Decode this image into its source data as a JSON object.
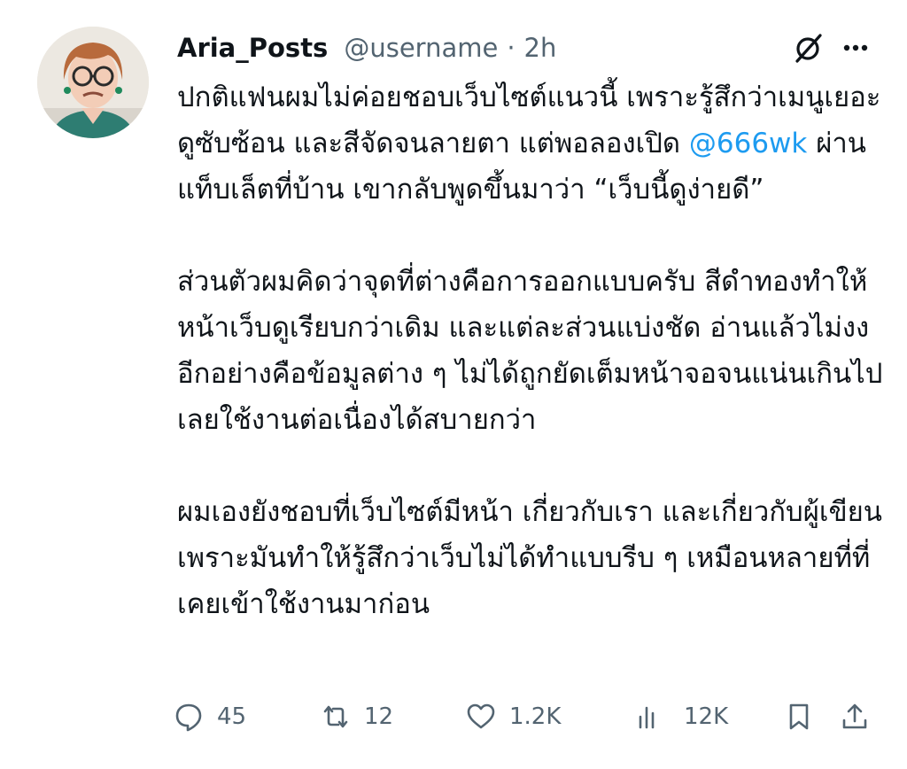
{
  "post": {
    "display_name": "Aria_Posts",
    "handle": "@username",
    "separator": "·",
    "time": "2h",
    "body": {
      "p1_before": "ปกติแฟนผมไม่ค่อยชอบเว็บไซต์แนวนี้ เพราะรู้สึกว่าเมนูเยอะ ดูซับซ้อน และสีจัดจนลายตา แต่พอลองเปิด ",
      "p1_mention": "@666wk",
      "p1_after": " ผ่านแท็บเล็ตที่บ้าน เขากลับพูดขึ้นมาว่า “เว็บนี้ดูง่ายดี”",
      "p2": "ส่วนตัวผมคิดว่าจุดที่ต่างคือการออกแบบครับ สีดำทองทำให้หน้าเว็บดูเรียบกว่าเดิม และแต่ละส่วนแบ่งชัด อ่านแล้วไม่งง อีกอย่างคือข้อมูลต่าง ๆ ไม่ได้ถูกยัดเต็มหน้าจอจนแน่นเกินไป เลยใช้งานต่อเนื่องได้สบายกว่า",
      "p3": "ผมเองยังชอบที่เว็บไซต์มีหน้า เกี่ยวกับเรา และเกี่ยวกับผู้เขียน เพราะมันทำให้รู้สึกว่าเว็บไม่ได้ทำแบบรีบ ๆ เหมือนหลายที่ที่เคยเข้าใช้งานมาก่อน"
    },
    "actions": {
      "replies": "45",
      "reposts": "12",
      "likes": "1.2K",
      "views": "12K"
    }
  },
  "icons": {
    "grok": "grok-icon",
    "more": "more-icon",
    "reply": "reply-icon",
    "repost": "repost-icon",
    "like": "like-icon",
    "views": "views-icon",
    "bookmark": "bookmark-icon",
    "share": "share-icon"
  },
  "colors": {
    "text": "#0f1419",
    "secondary": "#536471",
    "link": "#1d9bf0"
  }
}
